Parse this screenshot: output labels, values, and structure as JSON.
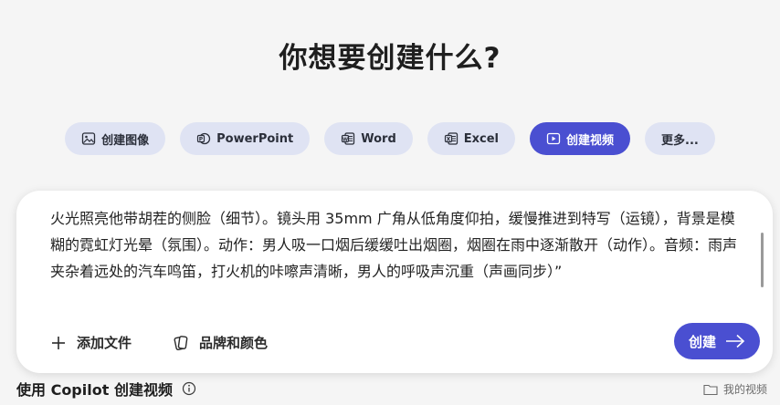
{
  "page": {
    "title": "你想要创建什么?"
  },
  "chips": [
    {
      "label": "创建图像",
      "icon": "image-icon"
    },
    {
      "label": "PowerPoint",
      "icon": "powerpoint-icon"
    },
    {
      "label": "Word",
      "icon": "word-icon"
    },
    {
      "label": "Excel",
      "icon": "excel-icon"
    },
    {
      "label": "创建视频",
      "icon": "video-icon",
      "active": true
    },
    {
      "label": "更多..."
    }
  ],
  "prompt": {
    "text": "火光照亮他带胡茬的侧脸（细节）。镜头用 35mm 广角从低角度仰拍，缓慢推进到特写（运镜），背景是模糊的霓虹灯光晕（氛围）。动作：男人吸一口烟后缓缓吐出烟圈，烟圈在雨中逐渐散开（动作）。音频：雨声夹杂着远处的汽车鸣笛，打火机的咔嚓声清晰，男人的呼吸声沉重（声画同步）”"
  },
  "card_actions": {
    "add_file": "添加文件",
    "brand_colors": "品牌和颜色",
    "create": "创建"
  },
  "footer": {
    "left_label": "使用 Copilot 创建视频",
    "right_label": "我的视频"
  },
  "colors": {
    "accent": "#4a4fd1",
    "chip_bg": "#dfe3f3",
    "page_bg": "#f5f5f5"
  }
}
